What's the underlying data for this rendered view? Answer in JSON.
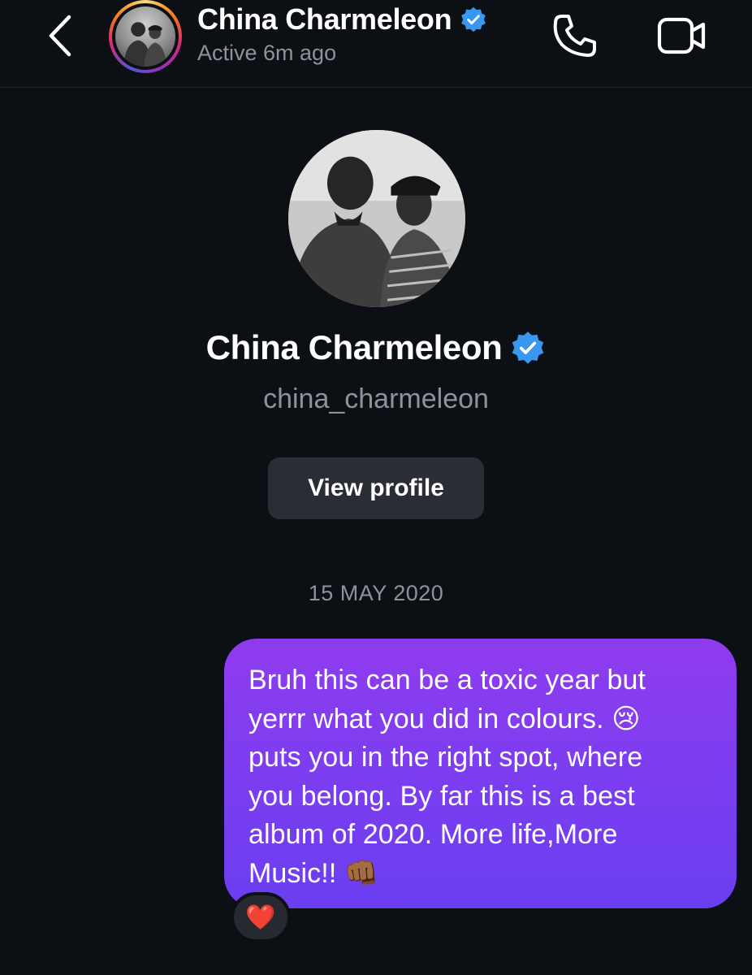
{
  "header": {
    "name": "China Charmeleon",
    "status": "Active 6m ago"
  },
  "profile": {
    "name": "China Charmeleon",
    "handle": "china_charmeleon",
    "view_profile_label": "View profile"
  },
  "conversation": {
    "date_separator": "15 MAY 2020",
    "messages": [
      {
        "direction": "outgoing",
        "text": "Bruh this can be a toxic year but\nyerrr what you did in colours. 😢\nputs you in the right spot, where\nyou belong. By far this is a best\nalbum of 2020. More life,More\nMusic!! 👊🏾",
        "reaction": "❤️"
      }
    ]
  },
  "icons": {
    "back": "chevron-left-icon",
    "verified": "verified-badge-icon",
    "call": "phone-icon",
    "video": "video-camera-icon"
  },
  "colors": {
    "background": "#0c0f13",
    "bubble": "#7a3ef0",
    "verified": "#3897f0",
    "secondary_text": "#8e929a",
    "button": "#2a2d33"
  }
}
